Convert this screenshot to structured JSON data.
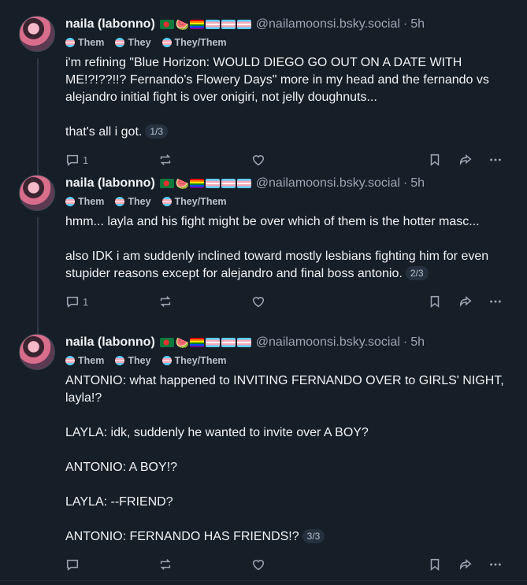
{
  "posts": [
    {
      "name": "naila (labonno)",
      "flags": [
        "bangladesh-flag",
        "watermelon",
        "pride-flag",
        "trans-flag",
        "trans-flag",
        "trans-flag"
      ],
      "handle": "@nailamoonsi.bsky.social",
      "separator": "·",
      "time": "5h",
      "labels": [
        "Them",
        "They",
        "They/Them"
      ],
      "text": "i'm refining \"Blue Horizon: WOULD DIEGO GO OUT ON A DATE WITH ME!?!??!!? Fernando's Flowery Days\" more in my head and the fernando vs alejandro initial fight is over onigiri, not jelly doughnuts...\n\nthat's all i got.",
      "thread_index": "1/3",
      "reply_count": "1"
    },
    {
      "name": "naila (labonno)",
      "flags": [
        "bangladesh-flag",
        "watermelon",
        "pride-flag",
        "trans-flag",
        "trans-flag",
        "trans-flag"
      ],
      "handle": "@nailamoonsi.bsky.social",
      "separator": "·",
      "time": "5h",
      "labels": [
        "Them",
        "They",
        "They/Them"
      ],
      "text": "hmm... layla and his fight might be over which of them is the hotter masc...\n\nalso IDK i am suddenly inclined toward mostly lesbians fighting him for even stupider reasons except for alejandro and final boss antonio.",
      "thread_index": "2/3",
      "reply_count": "1"
    },
    {
      "name": "naila (labonno)",
      "flags": [
        "bangladesh-flag",
        "watermelon",
        "pride-flag",
        "trans-flag",
        "trans-flag",
        "trans-flag"
      ],
      "handle": "@nailamoonsi.bsky.social",
      "separator": "·",
      "time": "5h",
      "labels": [
        "Them",
        "They",
        "They/Them"
      ],
      "text": "ANTONIO: what happened to INVITING FERNANDO OVER to GIRLS' NIGHT, layla!?\n\nLAYLA: idk, suddenly he wanted to invite over A BOY?\n\nANTONIO: A BOY!?\n\nLAYLA: --FRIEND?\n\nANTONIO: FERNANDO HAS FRIENDS!?",
      "thread_index": "3/3",
      "reply_count": ""
    }
  ],
  "colors": {
    "background": "#161e27",
    "text": "#f1f3f5",
    "muted": "#9aa6b4",
    "thread_line": "#2e3947"
  }
}
